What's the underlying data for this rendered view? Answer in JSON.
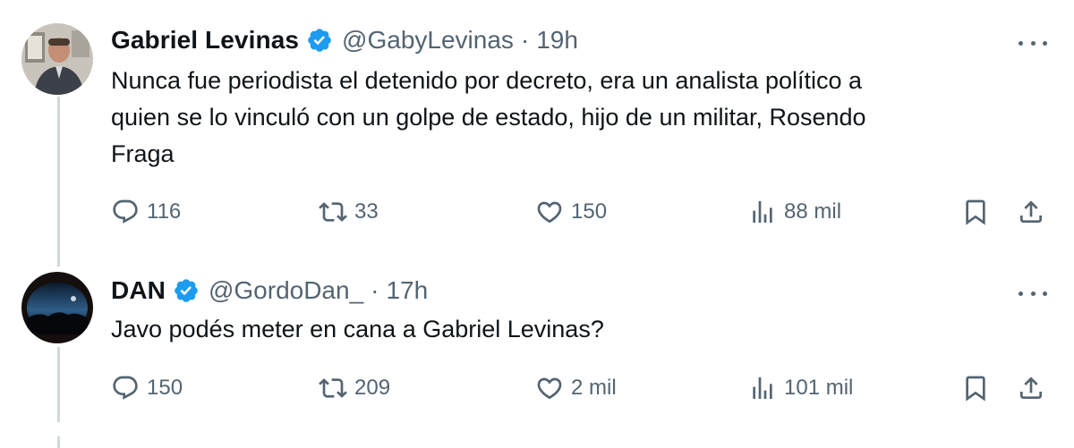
{
  "tweets": [
    {
      "name": "Gabriel Levinas",
      "handle": "@GabyLevinas",
      "separator": "·",
      "time": "19h",
      "text": "Nunca fue periodista el detenido por decreto, era un analista político a quien se lo vinculó con un golpe de estado, hijo de un militar, Rosendo Fraga",
      "text_lines": [
        "Nunca fue periodista el detenido por decreto, era un analista político a",
        "quien se lo vinculó con un golpe de estado, hijo de un militar, Rosendo",
        "Fraga"
      ],
      "replies": "116",
      "retweets": "33",
      "likes": "150",
      "views": "88 mil"
    },
    {
      "name": "DAN",
      "handle": "@GordoDan_",
      "separator": "·",
      "time": "17h",
      "text_lines": [
        "Javo podés meter en cana a Gabriel Levinas?"
      ],
      "replies": "150",
      "retweets": "209",
      "likes": "2 mil",
      "views": "101 mil"
    }
  ],
  "icons": {
    "verified": "verified-badge-icon",
    "reply": "reply-icon",
    "retweet": "retweet-icon",
    "like": "heart-icon",
    "views": "analytics-icon",
    "bookmark": "bookmark-icon",
    "share": "share-icon",
    "more": "more-icon"
  },
  "colors": {
    "verified": "#1d9bf0",
    "text": "#0f1419",
    "secondary": "#536471",
    "thread_line": "#cfd9de"
  }
}
